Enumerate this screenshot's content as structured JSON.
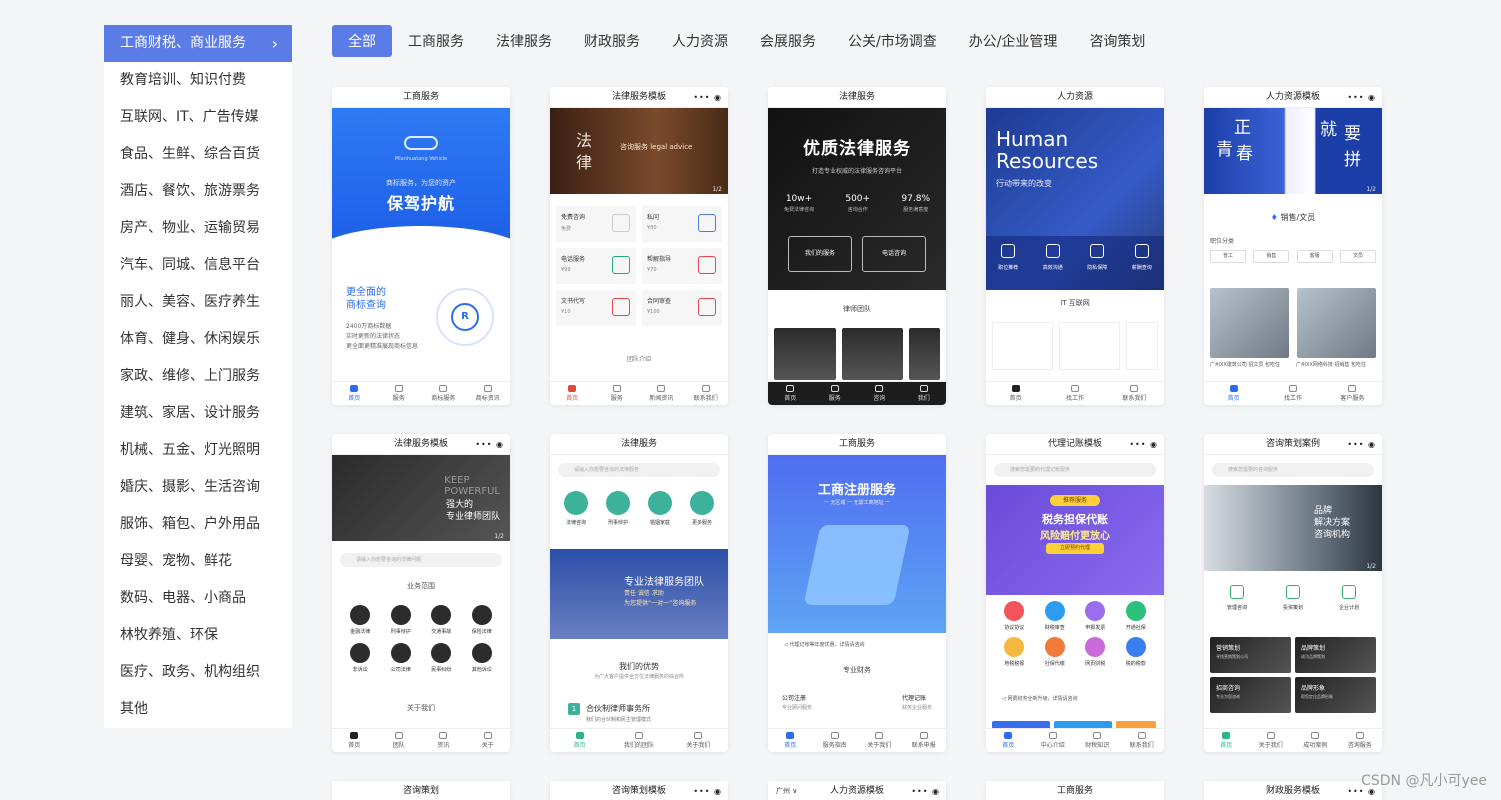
{
  "sidebar": {
    "items": [
      {
        "label": "工商财税、商业服务",
        "active": true
      },
      {
        "label": "教育培训、知识付费"
      },
      {
        "label": "互联网、IT、广告传媒"
      },
      {
        "label": "食品、生鲜、综合百货"
      },
      {
        "label": "酒店、餐饮、旅游票务"
      },
      {
        "label": "房产、物业、运输贸易"
      },
      {
        "label": "汽车、同城、信息平台"
      },
      {
        "label": "丽人、美容、医疗养生"
      },
      {
        "label": "体育、健身、休闲娱乐"
      },
      {
        "label": "家政、维修、上门服务"
      },
      {
        "label": "建筑、家居、设计服务"
      },
      {
        "label": "机械、五金、灯光照明"
      },
      {
        "label": "婚庆、摄影、生活咨询"
      },
      {
        "label": "服饰、箱包、户外用品"
      },
      {
        "label": "母婴、宠物、鲜花"
      },
      {
        "label": "数码、电器、小商品"
      },
      {
        "label": "林牧养殖、环保"
      },
      {
        "label": "医疗、政务、机构组织"
      },
      {
        "label": "其他"
      }
    ],
    "chevron": "›"
  },
  "tabs": [
    "全部",
    "工商服务",
    "法律服务",
    "财政服务",
    "人力资源",
    "会展服务",
    "公关/市场调查",
    "办公/企业管理",
    "咨询策划"
  ],
  "icons": {
    "capsule": "•••  ◉"
  },
  "cards": {
    "c1": {
      "title": "工商服务",
      "logo_text": "Mianhuatang Vehicle",
      "sub": "商标服务，为您的资产",
      "big": "保驾护航",
      "h1a": "更全面的",
      "h1b": "商标查询",
      "p1": "2400万商标数据",
      "p2": "实时更新的法律状态",
      "p3": "更全面更精准展现商标信息",
      "ring": "R",
      "foot": [
        "首页",
        "服务",
        "商标服务",
        "商标资讯"
      ]
    },
    "c2": {
      "title": "法律服务模板",
      "fa": "法",
      "lv": "律",
      "adv": "咨询服务 legal advice",
      "page": "1/2",
      "cells": [
        {
          "t": "免费咨询",
          "p": "免费"
        },
        {
          "t": "私问",
          "p": "¥80"
        },
        {
          "t": "电话服务",
          "p": "¥99"
        },
        {
          "t": "帮解指导",
          "p": "¥70"
        },
        {
          "t": "文书代写",
          "p": "¥10"
        },
        {
          "t": "合同审查",
          "p": "¥100"
        }
      ],
      "team": "团队介绍",
      "foot": [
        "首页",
        "服务",
        "新闻资讯",
        "联系我们"
      ]
    },
    "c3": {
      "title": "法律服务",
      "big": "优质法律服务",
      "sub": "打造专业权威的法律服务咨询平台",
      "stats": [
        {
          "n": "10w+",
          "l": "免费法律咨询"
        },
        {
          "n": "500+",
          "l": "咨询合作"
        },
        {
          "n": "97.8%",
          "l": "服务满意度"
        }
      ],
      "btn1": "我们的服务",
      "btn2": "电话咨询",
      "team": "律师团队",
      "foot": [
        "首页",
        "服务",
        "咨询",
        "我们"
      ]
    },
    "c4": {
      "title": "人力资源",
      "h1": "Human",
      "h2": "Resources",
      "sub": "行动带来的改变",
      "icons": [
        "职位推荐",
        "高效沟通",
        "隐私保障",
        "薪酬查询"
      ],
      "it": "IT 互联网",
      "foot": [
        "首页",
        "找工作",
        "联系我们"
      ]
    },
    "c5": {
      "title": "人力资源模板",
      "slogan": [
        "正",
        "青",
        "春",
        "就",
        "要",
        "拼"
      ],
      "page": "1/2",
      "role": "销售/文员",
      "label": "职位分类",
      "tags": [
        "普工",
        "销售",
        "客服",
        "文员"
      ],
      "cap1": "广州XX建筑公司 招文员 包吃住",
      "cap2": "广州XX网络科技 招销售 包吃住",
      "foot": [
        "首页",
        "找工作",
        "客户服务"
      ]
    },
    "c6": {
      "title": "法律服务模板",
      "kp1": "KEEP",
      "kp2": "POWERFUL",
      "team1": "强大的",
      "team2": "专业律师团队",
      "page": "1/2",
      "search": "请输入你想要咨询的法律问题",
      "sec": "业务范围",
      "grid": [
        "金融法律",
        "刑事辩护",
        "交通事故",
        "保险法律",
        "非诉讼",
        "公司法律",
        "民事纠纷",
        "其他诉讼"
      ],
      "about": "关于我们",
      "foot": [
        "首页",
        "团队",
        "资讯",
        "关于"
      ]
    },
    "c7": {
      "title": "法律服务",
      "search": "请输入你想要咨询的法律服务",
      "icons": [
        "法律咨询",
        "刑事辩护",
        "婚姻家庭",
        "更多服务"
      ],
      "ht": "专业法律服务团队",
      "hs1": "责任 诚信 求助",
      "hs2": "为您提供“一对一”咨询服务",
      "adv": "我们的优势",
      "adv2": "为广大客户提供全方位法律服务的综合所",
      "num": "1",
      "firm": "合伙制律师事务所",
      "firm2": "我们的合伙制和民主管理模式",
      "foot": [
        "首页",
        "我们的团队",
        "关于我们"
      ]
    },
    "c8": {
      "title": "工商服务",
      "big": "工商注册服务",
      "sub": "一 无区域 一 无需工商地址 一",
      "note": "代理记账等年度优惠，详情请咨询",
      "sec": "专业财务",
      "i1a": "公司注册",
      "i1b": "专业顾问服务",
      "i2a": "代理记账",
      "i2b": "财务企业服务",
      "foot": [
        "首页",
        "服务指南",
        "关于我们",
        "联系申报"
      ]
    },
    "c9": {
      "title": "代理记账模板",
      "search": "搜索您需要的代理记账服务",
      "badge": "推荐服务",
      "t1": "税务担保代账",
      "t2": "风险赔付更放心",
      "t3": "立即预约代理",
      "grid": [
        "协议协议",
        "财税审查",
        "申报发票",
        "开通社保",
        "地税税报",
        "社保代缴",
        "网页财税",
        "税的税款"
      ],
      "note": "网费财务全新升级，详情请咨询",
      "btns": [
        "上门服务",
        "全面审计",
        "团队服"
      ],
      "foot": [
        "首页",
        "中心介绍",
        "财税知识",
        "联系我们"
      ]
    },
    "c10": {
      "title": "咨询策划案例",
      "search": "搜索您需要的咨询服务",
      "t1": "品牌",
      "t2": "解决方案",
      "t3": "咨询机构",
      "page": "1/2",
      "icons": [
        "管理咨询",
        "投资策划",
        "企业计划"
      ],
      "cells": [
        {
          "t": "营销策划",
          "s": "寻找营销策划公司"
        },
        {
          "t": "品牌策划",
          "s": "成功品牌策划"
        },
        {
          "t": "招商咨询",
          "s": "专业为您咨询"
        },
        {
          "t": "品牌形象",
          "s": "帮您定位品牌形象"
        }
      ],
      "foot": [
        "首页",
        "关于我们",
        "成功案例",
        "咨询服务"
      ]
    },
    "row3": {
      "t1": "咨询策划",
      "t2": "咨询策划模板",
      "loc": "广州 ∨",
      "t3": "人力资源模板",
      "t4": "工商服务",
      "t5": "财政服务模板"
    }
  },
  "watermark": "CSDN @凡小可yee",
  "colors": {
    "accent": "#5b7be6",
    "blue": "#2b6cf0",
    "green": "#3cb29a"
  }
}
